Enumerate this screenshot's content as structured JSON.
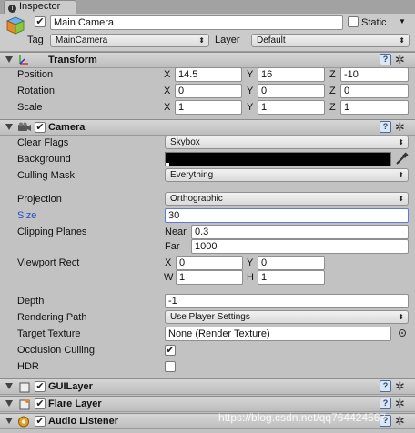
{
  "tab": {
    "label": "Inspector"
  },
  "gameobject": {
    "name": "Main Camera",
    "static_label": "Static",
    "tag_label": "Tag",
    "tag_value": "MainCamera",
    "layer_label": "Layer",
    "layer_value": "Default"
  },
  "transform": {
    "title": "Transform",
    "position_label": "Position",
    "rotation_label": "Rotation",
    "scale_label": "Scale",
    "axis_x": "X",
    "axis_y": "Y",
    "axis_z": "Z",
    "position": {
      "x": "14.5",
      "y": "16",
      "z": "-10"
    },
    "rotation": {
      "x": "0",
      "y": "0",
      "z": "0"
    },
    "scale": {
      "x": "1",
      "y": "1",
      "z": "1"
    }
  },
  "camera": {
    "title": "Camera",
    "clear_flags_label": "Clear Flags",
    "clear_flags_value": "Skybox",
    "background_label": "Background",
    "culling_mask_label": "Culling Mask",
    "culling_mask_value": "Everything",
    "projection_label": "Projection",
    "projection_value": "Orthographic",
    "size_label": "Size",
    "size_value": "30",
    "clipping_label": "Clipping Planes",
    "near_label": "Near",
    "near_value": "0.3",
    "far_label": "Far",
    "far_value": "1000",
    "viewport_label": "Viewport Rect",
    "vp_x_label": "X",
    "vp_x": "0",
    "vp_y_label": "Y",
    "vp_y": "0",
    "vp_w_label": "W",
    "vp_w": "1",
    "vp_h_label": "H",
    "vp_h": "1",
    "depth_label": "Depth",
    "depth_value": "-1",
    "rendering_path_label": "Rendering Path",
    "rendering_path_value": "Use Player Settings",
    "target_texture_label": "Target Texture",
    "target_texture_value": "None (Render Texture)",
    "occlusion_label": "Occlusion Culling",
    "hdr_label": "HDR"
  },
  "components": {
    "guilayer": "GUILayer",
    "flarelayer": "Flare Layer",
    "audiolistener": "Audio Listener"
  },
  "watermark": "https://blog.csdn.net/qq764424567",
  "colors": {
    "background_color": "#000000",
    "size_label_color": "#2a4fc7",
    "panel": "#c2c2c2"
  }
}
